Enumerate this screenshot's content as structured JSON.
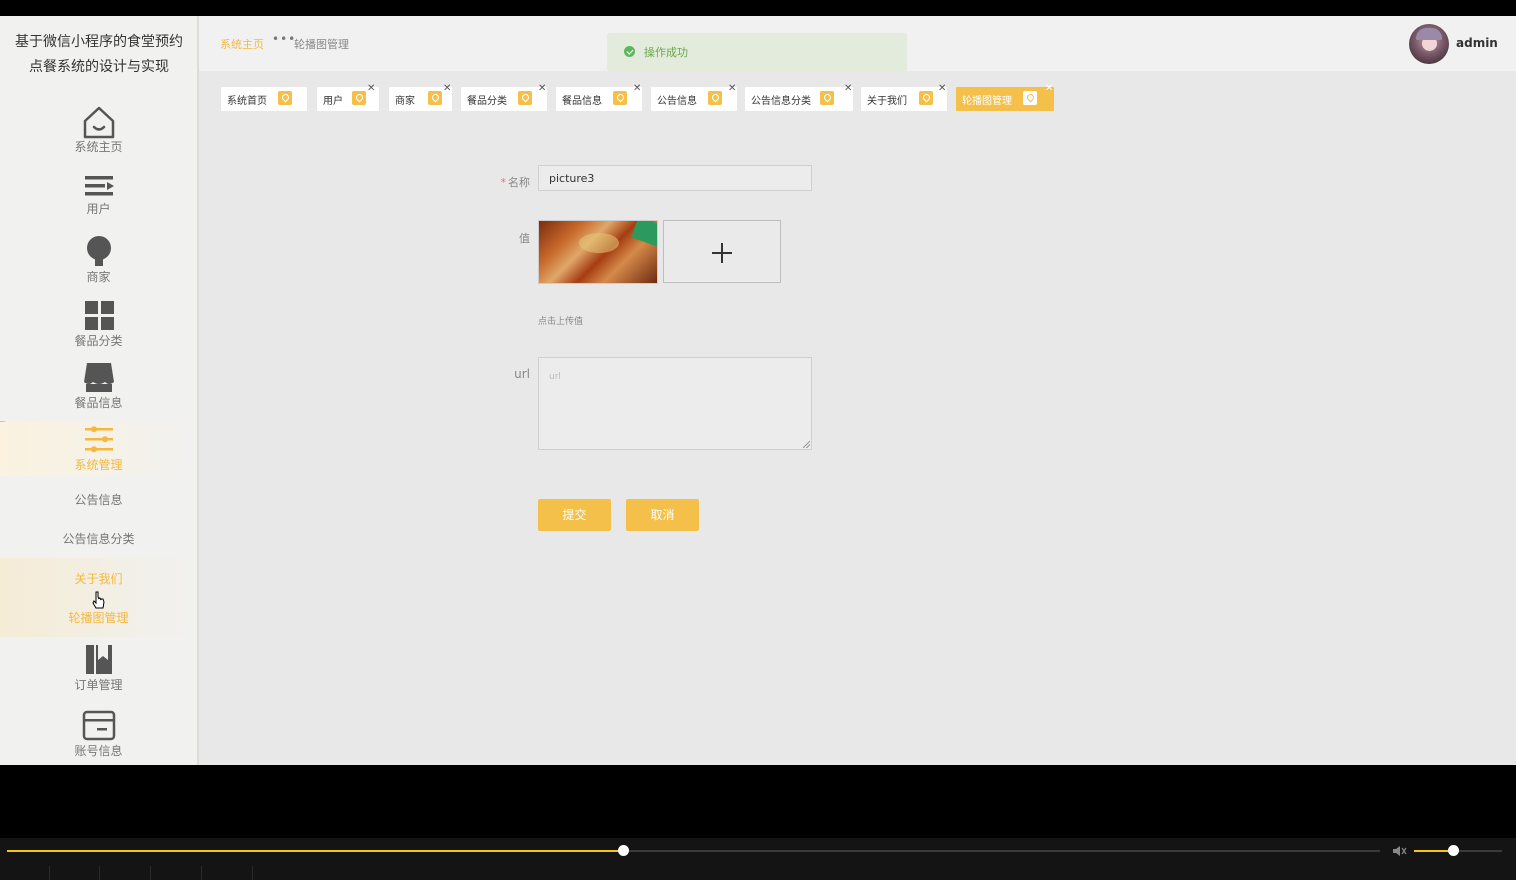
{
  "app": {
    "title": "基于微信小程序的食堂预约点餐系统的设计与实现"
  },
  "sidebar": {
    "items": [
      {
        "label": "系统主页",
        "icon": "home-icon"
      },
      {
        "label": "用户",
        "icon": "list-icon"
      },
      {
        "label": "商家",
        "icon": "bulb-icon"
      },
      {
        "label": "餐品分类",
        "icon": "grid-icon"
      },
      {
        "label": "餐品信息",
        "icon": "shop-icon"
      },
      {
        "label": "系统管理",
        "icon": "sliders-icon"
      },
      {
        "label": "订单管理",
        "icon": "bookmark-icon"
      },
      {
        "label": "账号信息",
        "icon": "card-icon"
      }
    ],
    "subitems": [
      {
        "label": "公告信息"
      },
      {
        "label": "公告信息分类"
      },
      {
        "label": "关于我们"
      },
      {
        "label": "轮播图管理"
      }
    ]
  },
  "header": {
    "breadcrumb_home": "系统主页",
    "breadcrumb_current": "轮播图管理",
    "toast": "操作成功",
    "username": "admin"
  },
  "tabs": [
    {
      "label": "系统首页",
      "closable": false
    },
    {
      "label": "用户",
      "closable": true
    },
    {
      "label": "商家",
      "closable": true
    },
    {
      "label": "餐品分类",
      "closable": true
    },
    {
      "label": "餐品信息",
      "closable": true
    },
    {
      "label": "公告信息",
      "closable": true
    },
    {
      "label": "公告信息分类",
      "closable": true
    },
    {
      "label": "关于我们",
      "closable": true
    },
    {
      "label": "轮播图管理",
      "closable": true,
      "active": true
    }
  ],
  "form": {
    "name_label": "名称",
    "name_required": "*",
    "name_value": "picture3",
    "value_label": "值",
    "upload_hint": "点击上传值",
    "url_label": "url",
    "url_placeholder": "url",
    "submit_label": "提交",
    "cancel_label": "取消"
  },
  "player": {
    "progress_fraction": 0.4485,
    "volume_fraction": 0.44
  },
  "colors": {
    "accent": "#f5c04a",
    "player_progress": "#f5c518",
    "toast_bg": "#e3ecdc",
    "toast_text": "#67a84b"
  }
}
